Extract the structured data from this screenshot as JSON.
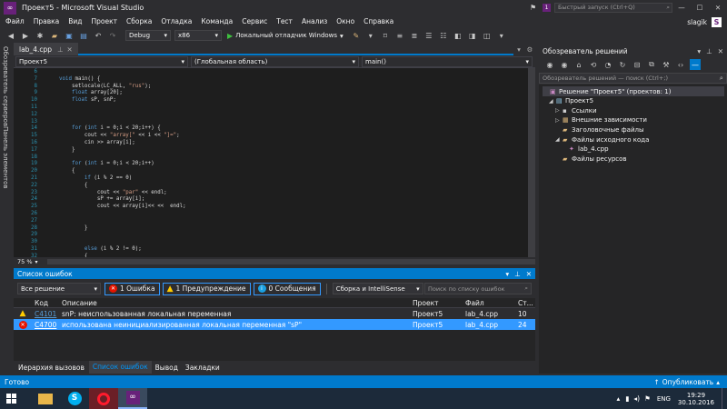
{
  "window": {
    "title": "Проект5 - Microsoft Visual Studio",
    "quick_launch_placeholder": "Быстрый запуск (Ctrl+Q)",
    "notification_count": "1",
    "user": "slagik",
    "user_avatar_letter": "S"
  },
  "menu": [
    "Файл",
    "Правка",
    "Вид",
    "Проект",
    "Сборка",
    "Отладка",
    "Команда",
    "Сервис",
    "Тест",
    "Анализ",
    "Окно",
    "Справка"
  ],
  "toolbar": {
    "config": "Debug",
    "platform": "x86",
    "run_label": "Локальный отладчик Windows"
  },
  "left_tabs": [
    "Обозреватель серверов",
    "Панель элементов"
  ],
  "editor": {
    "tab": "lab_4.cpp",
    "nav_project": "Проект5",
    "nav_scope": "(Глобальная область)",
    "nav_function": "main()",
    "zoom": "75 %",
    "lines": [
      {
        "n": "6",
        "t": ""
      },
      {
        "n": "7",
        "t": "void main() {"
      },
      {
        "n": "8",
        "t": "    setlocale(LC_ALL, \"rus\");"
      },
      {
        "n": "9",
        "t": "    float array[20];"
      },
      {
        "n": "10",
        "t": "    float sP, snP;"
      },
      {
        "n": "11",
        "t": ""
      },
      {
        "n": "12",
        "t": ""
      },
      {
        "n": "13",
        "t": ""
      },
      {
        "n": "14",
        "t": "    for (int i = 0;i < 20;i++) {"
      },
      {
        "n": "15",
        "t": "        cout << \"array[\" << i << \"]=\";"
      },
      {
        "n": "16",
        "t": "        cin >> array[i];"
      },
      {
        "n": "17",
        "t": "    }"
      },
      {
        "n": "18",
        "t": ""
      },
      {
        "n": "19",
        "t": "    for (int i = 0;i < 20;i++)"
      },
      {
        "n": "20",
        "t": "    {"
      },
      {
        "n": "21",
        "t": "        if (i % 2 == 0)"
      },
      {
        "n": "22",
        "t": "        {"
      },
      {
        "n": "23",
        "t": "            cout << \"par\" << endl;"
      },
      {
        "n": "24",
        "t": "            sP += array[i];"
      },
      {
        "n": "25",
        "t": "            cout << array[i]<< <<  endl;"
      },
      {
        "n": "26",
        "t": ""
      },
      {
        "n": "27",
        "t": ""
      },
      {
        "n": "28",
        "t": "        }"
      },
      {
        "n": "29",
        "t": ""
      },
      {
        "n": "30",
        "t": ""
      },
      {
        "n": "31",
        "t": "        else (i % 2 != 0);"
      },
      {
        "n": "32",
        "t": "        {"
      }
    ]
  },
  "error_list": {
    "title": "Список ошибок",
    "scope": "Все решение",
    "errors_btn": "1 Ошибка",
    "warnings_btn": "1 Предупреждение",
    "messages_btn": "0 Сообщения",
    "build_filter": "Сборка и IntelliSense",
    "search_placeholder": "Поиск по списку ошибок",
    "columns": {
      "code": "Код",
      "description": "Описание",
      "project": "Проект",
      "file": "Файл",
      "line": "Ст..."
    },
    "rows": [
      {
        "type": "warning",
        "code": "C4101",
        "description": "snP: неиспользованная локальная переменная",
        "project": "Проект5",
        "file": "lab_4.cpp",
        "line": "10"
      },
      {
        "type": "error",
        "code": "C4700",
        "description": "использована неинициализированная локальная переменная \"sP\"",
        "project": "Проект5",
        "file": "lab_4.cpp",
        "line": "24"
      }
    ]
  },
  "bottom_tabs": [
    "Иерархия вызовов",
    "Список ошибок",
    "Вывод",
    "Закладки"
  ],
  "solution_explorer": {
    "title": "Обозреватель решений",
    "search_placeholder": "Обозреватель решений — поиск (Ctrl+;)",
    "items": [
      {
        "label": "Решение \"Проект5\" (проектов: 1)",
        "indent": 0
      },
      {
        "label": "Проект5",
        "indent": 1
      },
      {
        "label": "Ссылки",
        "indent": 2
      },
      {
        "label": "Внешние зависимости",
        "indent": 2
      },
      {
        "label": "Заголовочные файлы",
        "indent": 2
      },
      {
        "label": "Файлы исходного кода",
        "indent": 2
      },
      {
        "label": "lab_4.cpp",
        "indent": 3
      },
      {
        "label": "Файлы ресурсов",
        "indent": 2
      }
    ]
  },
  "status": {
    "left": "Готово",
    "publish": "Опубликовать"
  },
  "taskbar": {
    "lang": "ENG",
    "time": "19:29",
    "date": "30.10.2016"
  },
  "colors": {
    "accent": "#007acc",
    "background": "#2d2d30",
    "editor": "#1e1e1e",
    "keyword": "#569cd6",
    "string": "#d69d85",
    "line_number": "#2b91af"
  }
}
